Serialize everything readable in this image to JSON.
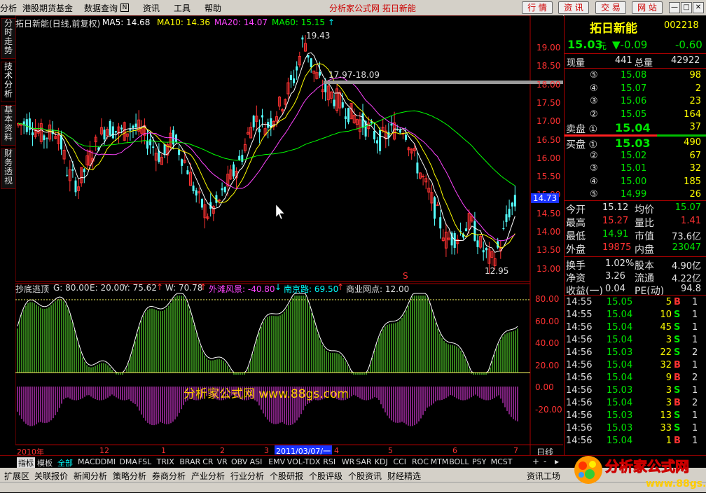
{
  "menu": {
    "items": [
      "分析",
      "港股期货基金",
      "数据查询",
      "资讯",
      "工具",
      "帮助"
    ],
    "center_title": "分析家公式网  拓日新能",
    "buttons": [
      "行 情",
      "资 讯",
      "交 易",
      "网 站"
    ]
  },
  "left_tabs": [
    "分时走势",
    "技术分析",
    "基本资料",
    "财务透视"
  ],
  "main_chart": {
    "header": {
      "title": "拓日新能(日线,前复权)",
      "ma5": "MA5: 14.68",
      "ma10": "MA10: 14.36",
      "ma20": "MA20: 14.07",
      "ma60": "MA60: 15.15"
    },
    "y_ticks": [
      "19.00",
      "18.50",
      "18.00",
      "17.50",
      "17.00",
      "16.50",
      "16.00",
      "15.50",
      "15.00",
      "14.50",
      "14.00",
      "13.50",
      "13.00"
    ],
    "current_price_tag": "14.73",
    "annotations": {
      "high": "19.43",
      "low": "12.95",
      "resistance": "17.97-18.09"
    }
  },
  "sub_chart": {
    "header": {
      "name": "抄底逃顶",
      "g": "G: 80.00",
      "e": "E: 20.00",
      "y": "Y: 75.62",
      "w": "W: 70.78",
      "wt": "外滩风景: -40.80",
      "nj": "南京路: 69.50",
      "sy": "商业网点: 12.00"
    },
    "y_ticks": [
      "80.00",
      "60.00",
      "40.00",
      "20.00",
      "0.00",
      "-20.00"
    ]
  },
  "x_axis": {
    "labels": [
      "2010年",
      "12",
      "1",
      "2",
      "3",
      "2011/03/07/一",
      "4",
      "5",
      "6",
      "7"
    ],
    "period": "日线"
  },
  "watermark": "分析家公式网 www.88gs.com",
  "quote": {
    "name": "拓日新能",
    "code": "002218",
    "price": "15.03",
    "unit": "元",
    "change": "▼-0.09",
    "pct": "-0.60",
    "xianliang_label": "现量",
    "xianliang": "441",
    "zongliang_label": "总量",
    "zongliang": "42922",
    "sell": [
      {
        "label": "⑤",
        "price": "15.08",
        "vol": "98"
      },
      {
        "label": "④",
        "price": "15.07",
        "vol": "2"
      },
      {
        "label": "③",
        "price": "15.06",
        "vol": "23"
      },
      {
        "label": "②",
        "price": "15.05",
        "vol": "164"
      },
      {
        "label": "卖盘 ①",
        "price": "15.04",
        "vol": "37"
      }
    ],
    "buy": [
      {
        "label": "买盘 ①",
        "price": "15.03",
        "vol": "490"
      },
      {
        "label": "②",
        "price": "15.02",
        "vol": "67"
      },
      {
        "label": "③",
        "price": "15.01",
        "vol": "32"
      },
      {
        "label": "④",
        "price": "15.00",
        "vol": "185"
      },
      {
        "label": "⑤",
        "price": "14.99",
        "vol": "26"
      }
    ],
    "stats": [
      {
        "l1": "今开",
        "v1": "15.12",
        "c1": "white",
        "l2": "均价",
        "v2": "15.07",
        "c2": "green"
      },
      {
        "l1": "最高",
        "v1": "15.27",
        "c1": "red",
        "l2": "量比",
        "v2": "1.41",
        "c2": "red"
      },
      {
        "l1": "最低",
        "v1": "14.91",
        "c1": "green",
        "l2": "市值",
        "v2": "73.6亿",
        "c2": "white"
      },
      {
        "l1": "外盘",
        "v1": "19875",
        "c1": "red",
        "l2": "内盘",
        "v2": "23047",
        "c2": "green"
      }
    ],
    "stats2": [
      {
        "l1": "换手",
        "v1": "1.02%",
        "l2": "股本",
        "v2": "4.90亿"
      },
      {
        "l1": "净资",
        "v1": "3.26",
        "l2": "流通",
        "v2": "4.22亿"
      },
      {
        "l1": "收益(一)",
        "v1": "0.04",
        "l2": "PE(动)",
        "v2": "94.8"
      }
    ],
    "ticks": [
      {
        "t": "14:55",
        "p": "15.05",
        "v": "5",
        "s": "B",
        "n": "1"
      },
      {
        "t": "14:55",
        "p": "15.04",
        "v": "10",
        "s": "S",
        "n": "1"
      },
      {
        "t": "14:56",
        "p": "15.04",
        "v": "45",
        "s": "S",
        "n": "1"
      },
      {
        "t": "14:56",
        "p": "15.04",
        "v": "3",
        "s": "S",
        "n": "1"
      },
      {
        "t": "14:56",
        "p": "15.03",
        "v": "22",
        "s": "S",
        "n": "2"
      },
      {
        "t": "14:56",
        "p": "15.04",
        "v": "32",
        "s": "B",
        "n": "1"
      },
      {
        "t": "14:56",
        "p": "15.04",
        "v": "9",
        "s": "B",
        "n": "2"
      },
      {
        "t": "14:56",
        "p": "15.03",
        "v": "3",
        "s": "S",
        "n": "1"
      },
      {
        "t": "14:56",
        "p": "15.04",
        "v": "3",
        "s": "B",
        "n": "2"
      },
      {
        "t": "14:56",
        "p": "15.03",
        "v": "13",
        "s": "S",
        "n": "1"
      },
      {
        "t": "14:56",
        "p": "15.03",
        "v": "33",
        "s": "S",
        "n": "1"
      },
      {
        "t": "14:56",
        "p": "15.04",
        "v": "1",
        "s": "B",
        "n": "1"
      }
    ]
  },
  "indicator_tabs": [
    "指标",
    "模板",
    "全部",
    "MACD",
    "DMI",
    "DMA",
    "FSL",
    "TRIX",
    "BRAR",
    "CR",
    "VR",
    "OBV",
    "ASI",
    "EMV",
    "VOL-TDX",
    "RSI",
    "WR",
    "SAR",
    "KDJ",
    "CCI",
    "ROC",
    "MTM",
    "BOLL",
    "PSY",
    "MCST"
  ],
  "bottom_tabs": [
    "扩展区",
    "关联报价",
    "新闻分析",
    "策略分析",
    "券商分析",
    "产业分析",
    "行业分析",
    "个股研报",
    "个股评级",
    "个股资讯",
    "财经精选"
  ],
  "bottom_right": "资讯工场",
  "logo": {
    "text": "分析家公式网",
    "url": "www.88gs.com"
  }
}
